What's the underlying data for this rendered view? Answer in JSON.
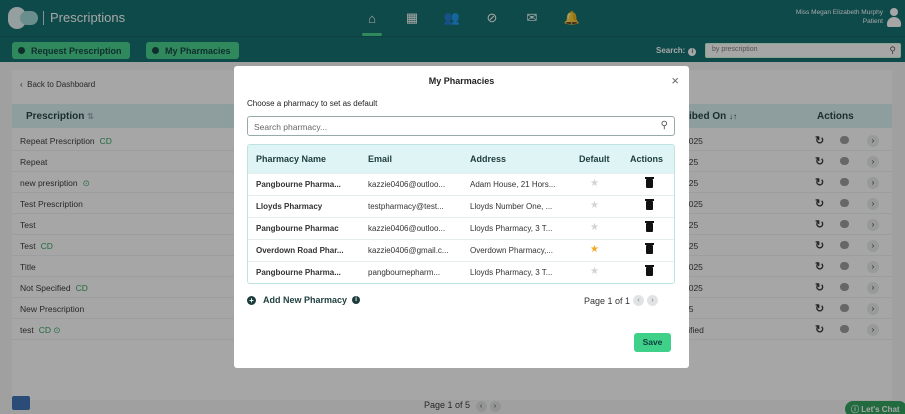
{
  "app": {
    "title": "Prescriptions"
  },
  "nav": {
    "icons": [
      "home-icon",
      "calendar-icon",
      "users-icon",
      "link-icon",
      "mail-icon",
      "bell-icon"
    ]
  },
  "user": {
    "name": "Miss Megan Elizabeth Murphy",
    "role": "Patient"
  },
  "toolbar": {
    "request_label": "Request Prescription",
    "pharmacies_label": "My Pharmacies",
    "search_label": "Search:",
    "search_placeholder": "by prescription"
  },
  "page": {
    "back_label": "Back to Dashboard",
    "col_prescription": "Prescription",
    "col_prescribed_on": "ibed On",
    "col_actions": "Actions",
    "rows": [
      {
        "name": "Repeat Prescription",
        "tag": "CD",
        "date": "2025"
      },
      {
        "name": "Repeat",
        "tag": "",
        "date": "025"
      },
      {
        "name": "new presription",
        "tag": "⊙",
        "date": "025"
      },
      {
        "name": "Test Prescription",
        "tag": "",
        "date": "2025"
      },
      {
        "name": "Test",
        "tag": "",
        "date": "025"
      },
      {
        "name": "Test",
        "tag": "CD",
        "date": "025"
      },
      {
        "name": "Title",
        "tag": "",
        "date": "2025"
      },
      {
        "name": "Not Specified",
        "tag": "CD",
        "date": "2025"
      },
      {
        "name": "New Prescription",
        "tag": "",
        "date": "25"
      },
      {
        "name": "test",
        "tag": "CD ⊙",
        "date": "cified"
      }
    ],
    "pager": "Page 1 of 5",
    "chat_label": "Let's Chat"
  },
  "modal": {
    "title": "My Pharmacies",
    "subtitle": "Choose a pharmacy to set as default",
    "search_placeholder": "Search pharmacy...",
    "headers": {
      "name": "Pharmacy Name",
      "email": "Email",
      "address": "Address",
      "default": "Default",
      "actions": "Actions"
    },
    "rows": [
      {
        "name": "Pangbourne Pharma...",
        "email": "kazzie0406@outloo...",
        "address": "Adam House, 21 Hors...",
        "is_default": false
      },
      {
        "name": "Lloyds Pharmacy",
        "email": "testpharmacy@test...",
        "address": "Lloyds Number One, ...",
        "is_default": false
      },
      {
        "name": "Pangbourne Pharmac",
        "email": "kazzie0406@outloo...",
        "address": "Lloyds Pharmacy, 3 T...",
        "is_default": false
      },
      {
        "name": "Overdown Road Phar...",
        "email": "kazzie0406@gmail.c...",
        "address": "Overdown Pharmacy,...",
        "is_default": true
      },
      {
        "name": "Pangbourne Pharma...",
        "email": "pangbournepharm...",
        "address": "Lloyds Pharmacy, 3 T...",
        "is_default": false
      }
    ],
    "add_label": "Add New Pharmacy",
    "pager": "Page 1 of 1",
    "save_label": "Save"
  },
  "colors": {
    "primary": "#0c6b6b",
    "accent": "#3fd08a",
    "star_active": "#f5a623",
    "star_inactive": "#d0d4d4"
  }
}
